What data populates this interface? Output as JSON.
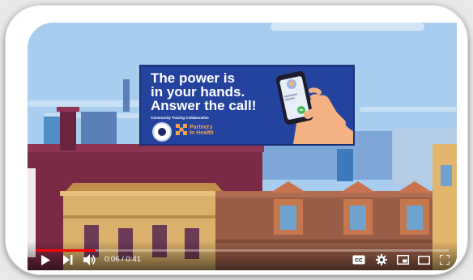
{
  "billboard": {
    "headline_1": "The power is",
    "headline_2": "in your hands.",
    "headline_3": "Answer the call!",
    "subtext": "Community Tracing Collaborative",
    "partner_1": "Partners",
    "partner_2": "In Health"
  },
  "player": {
    "current_time": "0:06",
    "separator": " / ",
    "duration": "0:41",
    "progress_percent": 14.6,
    "cc_label": "CC",
    "colors": {
      "progress": "#ff0000",
      "billboard": "#23439e",
      "pih_orange": "#f2a24a"
    }
  }
}
